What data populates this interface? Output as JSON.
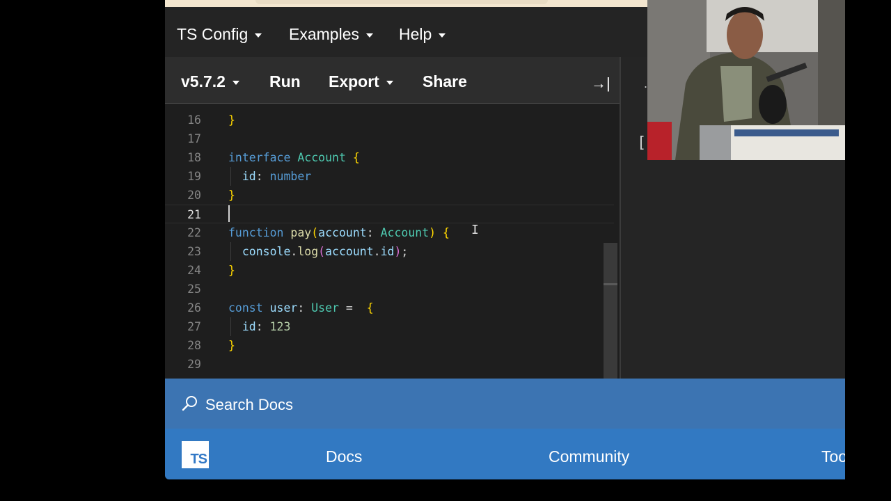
{
  "navbar": {
    "items": [
      {
        "label": "TS Config"
      },
      {
        "label": "Examples"
      },
      {
        "label": "Help"
      }
    ]
  },
  "toolbar": {
    "version_label": "v5.7.2",
    "run_label": "Run",
    "export_label": "Export",
    "share_label": "Share",
    "collapse_icon": "→|"
  },
  "editor": {
    "active_line": 21,
    "lines": [
      {
        "num": "16",
        "text": "}"
      },
      {
        "num": "17",
        "text": ""
      },
      {
        "num": "18",
        "text": "interface Account {"
      },
      {
        "num": "19",
        "text": "  id: number"
      },
      {
        "num": "20",
        "text": "}"
      },
      {
        "num": "21",
        "text": ""
      },
      {
        "num": "22",
        "text": "function pay(account: Account) {"
      },
      {
        "num": "23",
        "text": "  console.log(account.id);"
      },
      {
        "num": "24",
        "text": "}"
      },
      {
        "num": "25",
        "text": ""
      },
      {
        "num": "26",
        "text": "const user: User =  {"
      },
      {
        "num": "27",
        "text": "  id: 123"
      },
      {
        "num": "28",
        "text": "}"
      },
      {
        "num": "29",
        "text": ""
      }
    ]
  },
  "right_pane": {
    "glyph_top": ".",
    "glyph_bracket": "["
  },
  "search": {
    "label": "Search Docs",
    "icon": "search-icon"
  },
  "footer": {
    "logo_text": "TS",
    "links": [
      {
        "label": "Docs"
      },
      {
        "label": "Community"
      },
      {
        "label": "Too"
      }
    ]
  },
  "colors": {
    "navbar_bg": "#242424",
    "toolbar_bg": "#2d2d2d",
    "editor_bg": "#1e1e1e",
    "search_bar_bg": "#3c74b2",
    "footer_bg": "#3279c2",
    "keyword": "#569cd6",
    "type": "#4ec9b0",
    "function": "#dcdcaa",
    "bracket": "#ffd700"
  }
}
